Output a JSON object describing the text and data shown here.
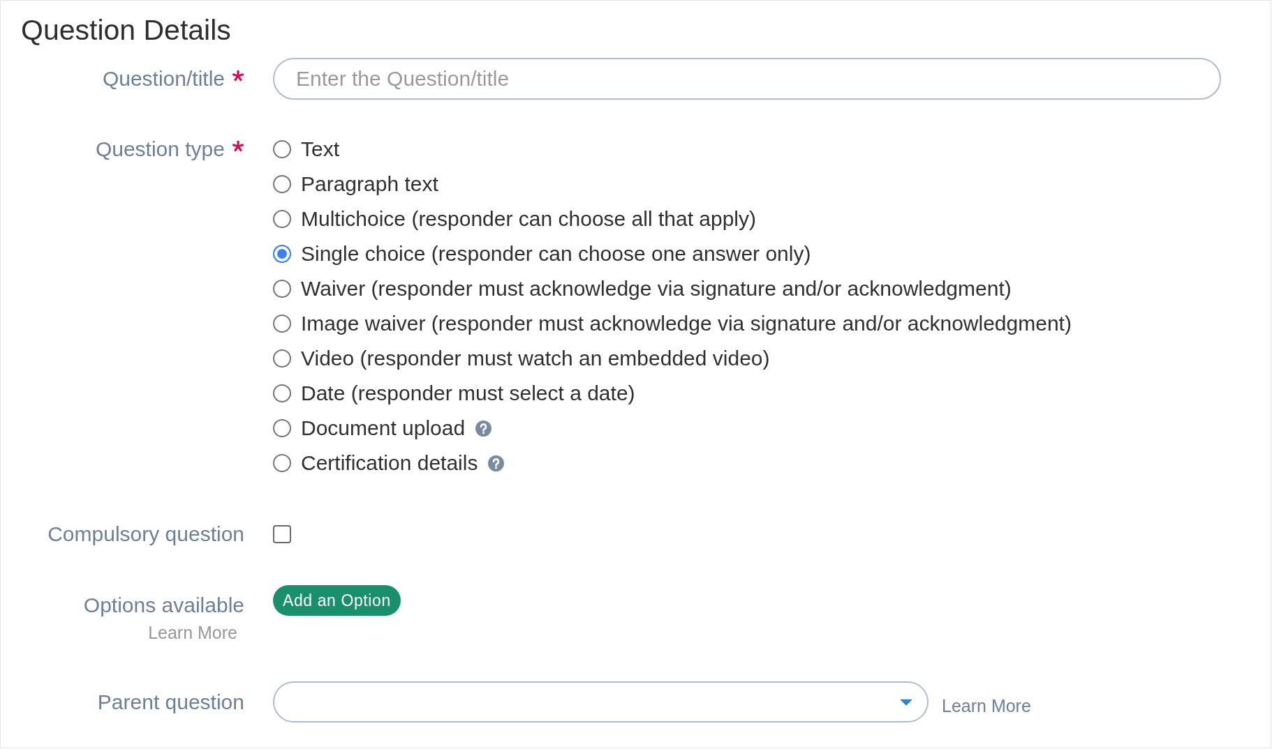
{
  "form": {
    "title": "Question Details",
    "rows": [
      {
        "kind": "text",
        "label": "Question/title",
        "required": true,
        "placeholder": "Enter the Question/title"
      },
      {
        "kind": "radio",
        "label": "Question type",
        "required": true,
        "options": [
          {
            "label": "Text",
            "selected": false,
            "help": false
          },
          {
            "label": "Paragraph text",
            "selected": false,
            "help": false
          },
          {
            "label": "Multichoice (responder can choose all that apply)",
            "selected": false,
            "help": false
          },
          {
            "label": "Single choice (responder can choose one answer only)",
            "selected": true,
            "help": false
          },
          {
            "label": "Waiver (responder must acknowledge via signature and/or acknowledgment)",
            "selected": false,
            "help": false
          },
          {
            "label": "Image waiver (responder must acknowledge via signature and/or acknowledgment)",
            "selected": false,
            "help": false
          },
          {
            "label": "Video (responder must watch an embedded video)",
            "selected": false,
            "help": false
          },
          {
            "label": "Date (responder must select a date)",
            "selected": false,
            "help": false
          },
          {
            "label": "Document upload",
            "selected": false,
            "help": true
          },
          {
            "label": "Certification details",
            "selected": false,
            "help": true
          }
        ]
      },
      {
        "kind": "checkbox",
        "label": "Compulsory question",
        "required": false,
        "checked": false
      },
      {
        "kind": "button",
        "label": "Options available",
        "required": false,
        "hint": "Learn More",
        "button": "Add an Option"
      },
      {
        "kind": "select",
        "label": "Parent question",
        "required": false,
        "link": "Learn More"
      }
    ]
  }
}
